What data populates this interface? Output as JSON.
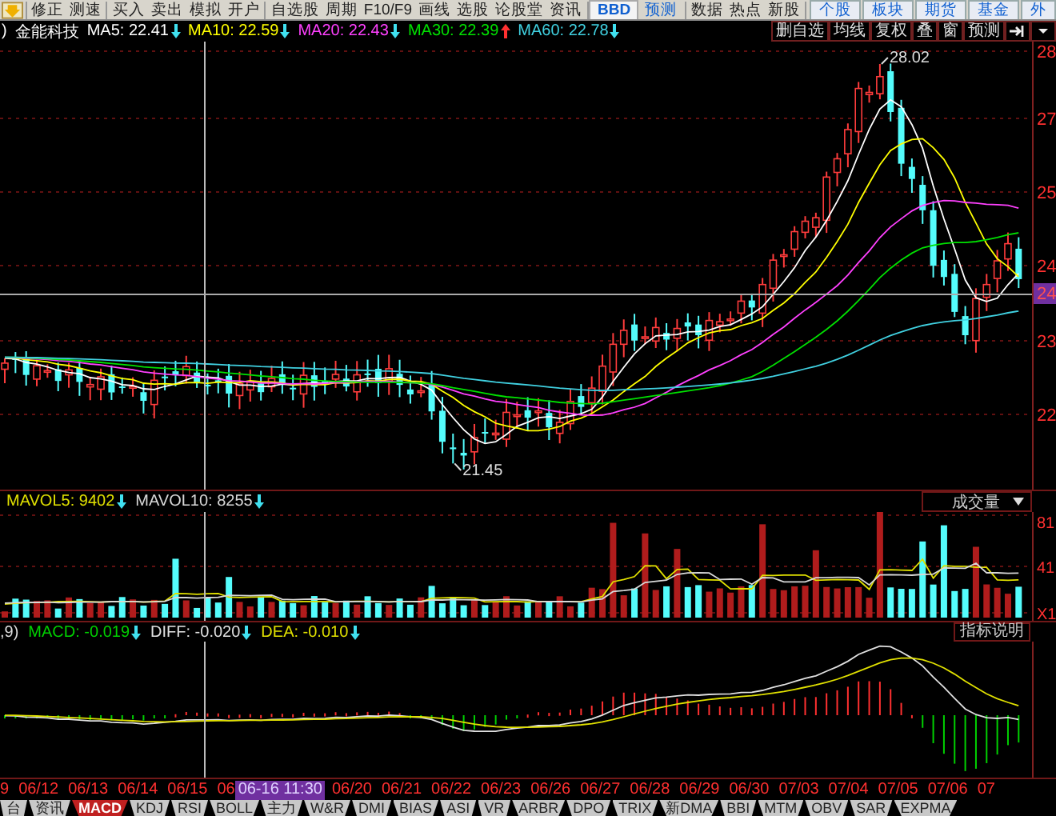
{
  "toolbar": [
    {
      "label": "修正",
      "kind": "plain"
    },
    {
      "label": "测速",
      "kind": "plain",
      "sep": true
    },
    {
      "label": "买入",
      "kind": "plain"
    },
    {
      "label": "卖出",
      "kind": "plain"
    },
    {
      "label": "模拟",
      "kind": "plain"
    },
    {
      "label": "开户",
      "kind": "plain",
      "sep": true
    },
    {
      "label": "自选股",
      "kind": "plain"
    },
    {
      "label": "周期",
      "kind": "plain"
    },
    {
      "label": "F10/F9",
      "kind": "plain"
    },
    {
      "label": "画线",
      "kind": "plain"
    },
    {
      "label": "选股",
      "kind": "plain"
    },
    {
      "label": "论股堂",
      "kind": "plain"
    },
    {
      "label": "资讯",
      "kind": "plain",
      "sep": true
    },
    {
      "label": "BBD",
      "kind": "accent"
    },
    {
      "label": "预测",
      "kind": "link",
      "sep": true
    },
    {
      "label": "数据",
      "kind": "plain"
    },
    {
      "label": "热点",
      "kind": "plain"
    },
    {
      "label": "新股",
      "kind": "plain",
      "sep": true
    },
    {
      "label": "个股",
      "kind": "nav"
    },
    {
      "label": "板块",
      "kind": "nav"
    },
    {
      "label": "期货",
      "kind": "nav"
    },
    {
      "label": "基金",
      "kind": "nav"
    },
    {
      "label": "外",
      "kind": "nav"
    }
  ],
  "quote_bar": {
    "prefix": ")",
    "name": "金能科技",
    "averages": [
      {
        "label": "MA5: 22.41",
        "color": "#ffffff",
        "falling": true
      },
      {
        "label": "MA10: 22.59",
        "color": "#ffff00",
        "falling": true
      },
      {
        "label": "MA20: 22.43",
        "color": "#ff40ff",
        "falling": true
      },
      {
        "label": "MA30: 22.39",
        "color": "#00e000",
        "falling": false
      },
      {
        "label": "MA60: 22.78",
        "color": "#40d0e0",
        "falling": true
      }
    ],
    "buttons": [
      "删自选",
      "均线",
      "复权",
      "叠",
      "窗",
      "预测"
    ]
  },
  "price_chart": {
    "axis_labels": [
      "28",
      "27",
      "25",
      "24",
      "23",
      "22"
    ],
    "high_label": "28.02",
    "low_label": "21.45",
    "crosshair_price": "24"
  },
  "volume_panel": {
    "indicators": [
      {
        "label": "MAVOL5: 9402",
        "color": "#e0e000",
        "falling": true
      },
      {
        "label": "MAVOL10: 8255",
        "color": "#d8d8d8",
        "falling": true
      }
    ],
    "selector": "成交量",
    "axis_labels": [
      "81",
      "41",
      "X1"
    ]
  },
  "macd_panel": {
    "prefix": ",9)",
    "indicators": [
      {
        "label": "MACD: -0.019",
        "color": "#00d000",
        "falling": true
      },
      {
        "label": "DIFF: -0.020",
        "color": "#e0e0e0",
        "falling": true
      },
      {
        "label": "DEA: -0.010",
        "color": "#e0e000",
        "falling": true
      }
    ],
    "help_button": "指标说明"
  },
  "date_axis": [
    {
      "text": "9",
      "kind": "date"
    },
    {
      "text": "06/12",
      "kind": "date"
    },
    {
      "text": "06/13",
      "kind": "date"
    },
    {
      "text": "06/14",
      "kind": "date"
    },
    {
      "text": "06/15",
      "kind": "date"
    },
    {
      "text": "06",
      "kind": "date"
    },
    {
      "text": "06-16 11:30",
      "kind": "cursor"
    },
    {
      "text": "06/20",
      "kind": "date"
    },
    {
      "text": "06/21",
      "kind": "date"
    },
    {
      "text": "06/22",
      "kind": "date"
    },
    {
      "text": "06/23",
      "kind": "date"
    },
    {
      "text": "06/26",
      "kind": "date"
    },
    {
      "text": "06/27",
      "kind": "date"
    },
    {
      "text": "06/28",
      "kind": "date"
    },
    {
      "text": "06/29",
      "kind": "date"
    },
    {
      "text": "06/30",
      "kind": "date"
    },
    {
      "text": "07/03",
      "kind": "date"
    },
    {
      "text": "07/04",
      "kind": "date"
    },
    {
      "text": "07/05",
      "kind": "date"
    },
    {
      "text": "07/06",
      "kind": "date"
    },
    {
      "text": "07",
      "kind": "date"
    }
  ],
  "indicator_tabs": [
    {
      "label": "台",
      "selected": false
    },
    {
      "label": "资讯",
      "selected": false
    },
    {
      "label": "MACD",
      "selected": true
    },
    {
      "label": "KDJ",
      "selected": false
    },
    {
      "label": "RSI",
      "selected": false
    },
    {
      "label": "BOLL",
      "selected": false
    },
    {
      "label": "主力",
      "selected": false
    },
    {
      "label": "W&R",
      "selected": false
    },
    {
      "label": "DMI",
      "selected": false
    },
    {
      "label": "BIAS",
      "selected": false
    },
    {
      "label": "ASI",
      "selected": false
    },
    {
      "label": "VR",
      "selected": false
    },
    {
      "label": "ARBR",
      "selected": false
    },
    {
      "label": "DPO",
      "selected": false
    },
    {
      "label": "TRIX",
      "selected": false
    },
    {
      "label": "新DMA",
      "selected": false
    },
    {
      "label": "BBI",
      "selected": false
    },
    {
      "label": "MTM",
      "selected": false
    },
    {
      "label": "OBV",
      "selected": false
    },
    {
      "label": "SAR",
      "selected": false
    },
    {
      "label": "EXPMA",
      "selected": false
    }
  ]
}
